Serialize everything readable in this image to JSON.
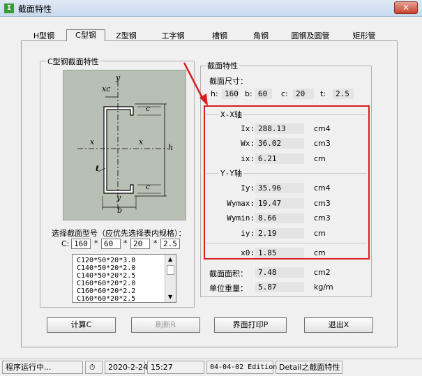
{
  "window": {
    "title": "截面特性",
    "close_label": "✕"
  },
  "tabs": [
    "H型钢",
    "C型钢",
    "Z型钢",
    "工字钢",
    "槽钢",
    "角钢",
    "圆钢及圆管",
    "矩形管"
  ],
  "left_group": {
    "title": "C型钢截面特性",
    "drawing_labels": {
      "xc": "xc",
      "y_top": "y",
      "y_bottom": "y",
      "x_left": "x",
      "x_right": "x",
      "c_top": "c",
      "c_bottom": "c",
      "h": "h",
      "t": "t",
      "b": "b"
    },
    "select_label": "选择截面型号（应优先选择表内规格）：",
    "c_label": "C:",
    "c_values": [
      "160",
      "60",
      "20",
      "2.5"
    ],
    "multiply": "*",
    "list_items": [
      "C120*50*20*3.0",
      "C140*50*20*2.0",
      "C140*50*20*2.5",
      "C160*60*20*2.0",
      "C160*60*20*2.2",
      "C160*60*20*2.5"
    ]
  },
  "right_group": {
    "title": "截面特性",
    "size_label": "截面尺寸：",
    "dims": [
      {
        "label": "h:",
        "value": "160"
      },
      {
        "label": "b:",
        "value": "60"
      },
      {
        "label": "c:",
        "value": "20"
      },
      {
        "label": "t:",
        "value": "2.5"
      }
    ],
    "xx_title": "X-X轴",
    "xx_props": [
      {
        "label": "Ix:",
        "value": "288.13",
        "unit": "cm4"
      },
      {
        "label": "Wx:",
        "value": "36.02",
        "unit": "cm3"
      },
      {
        "label": "ix:",
        "value": "6.21",
        "unit": "cm"
      }
    ],
    "yy_title": "Y-Y轴",
    "yy_props": [
      {
        "label": "Iy:",
        "value": "35.96",
        "unit": "cm4"
      },
      {
        "label": "Wymax:",
        "value": "19.47",
        "unit": "cm3"
      },
      {
        "label": "Wymin:",
        "value": "8.66",
        "unit": "cm3"
      },
      {
        "label": "iy:",
        "value": "2.19",
        "unit": "cm"
      }
    ],
    "x0": {
      "label": "x0:",
      "value": "1.85",
      "unit": "cm"
    },
    "area": {
      "label": "截面面积：",
      "value": "7.48",
      "unit": "cm2"
    },
    "weight": {
      "label": "单位重量：",
      "value": "5.87",
      "unit": "kg/m"
    }
  },
  "buttons": {
    "calc": "计算C",
    "refresh": "刷新R",
    "print": "界面打印P",
    "exit": "退出X"
  },
  "status": {
    "running": "程序运行中...",
    "date": "2020-2-24",
    "time": "15:27",
    "edition": "04-04-02 Edition",
    "detail": "Detail之截面特性"
  },
  "colors": {
    "highlight": "#d81e1e",
    "drawing_bg": "#b8bfb3",
    "section_shape": "#ffffff"
  }
}
